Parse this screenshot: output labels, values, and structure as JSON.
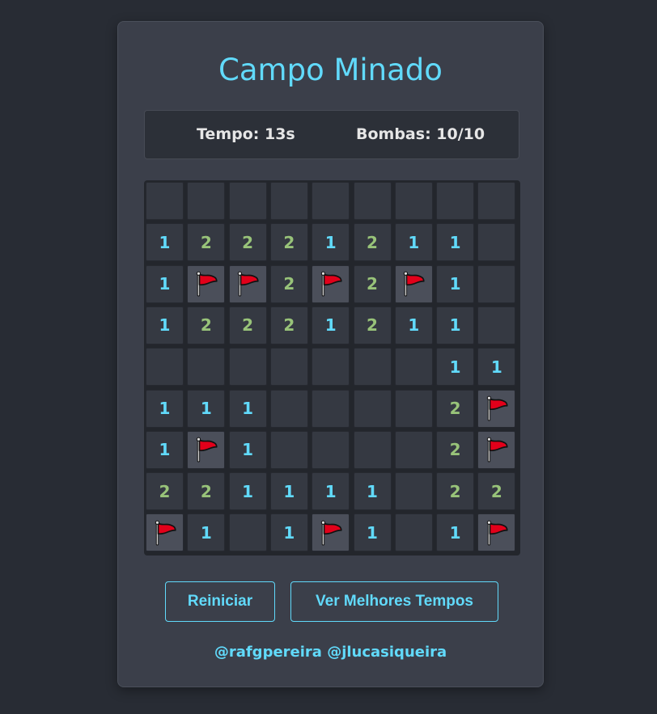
{
  "game": {
    "title": "Campo Minado",
    "stats": {
      "time": "Tempo: 13s",
      "bombs": "Bombas: 10/10"
    },
    "colors": {
      "accent": "#61dafb",
      "number_1": "#61dafb",
      "number_2": "#98c379",
      "flag_red": "#e2001a"
    },
    "board": {
      "rows": [
        [
          "",
          "",
          "",
          "",
          "",
          "",
          "",
          "",
          ""
        ],
        [
          "1",
          "2",
          "2",
          "2",
          "1",
          "2",
          "1",
          "1",
          ""
        ],
        [
          "1",
          "F",
          "F",
          "2",
          "F",
          "2",
          "F",
          "1",
          ""
        ],
        [
          "1",
          "2",
          "2",
          "2",
          "1",
          "2",
          "1",
          "1",
          ""
        ],
        [
          "",
          "",
          "",
          "",
          "",
          "",
          "",
          "1",
          "1"
        ],
        [
          "1",
          "1",
          "1",
          "",
          "",
          "",
          "",
          "2",
          "F"
        ],
        [
          "1",
          "F",
          "1",
          "",
          "",
          "",
          "",
          "2",
          "F"
        ],
        [
          "2",
          "2",
          "1",
          "1",
          "1",
          "1",
          "",
          "2",
          "2"
        ],
        [
          "F",
          "1",
          "",
          "1",
          "F",
          "1",
          "",
          "1",
          "F"
        ]
      ],
      "flag_icon": "flag-icon"
    },
    "buttons": {
      "restart": "Reiniciar",
      "best_times": "Ver Melhores Tempos"
    },
    "credits": "@rafgpereira @jlucasiqueira"
  }
}
